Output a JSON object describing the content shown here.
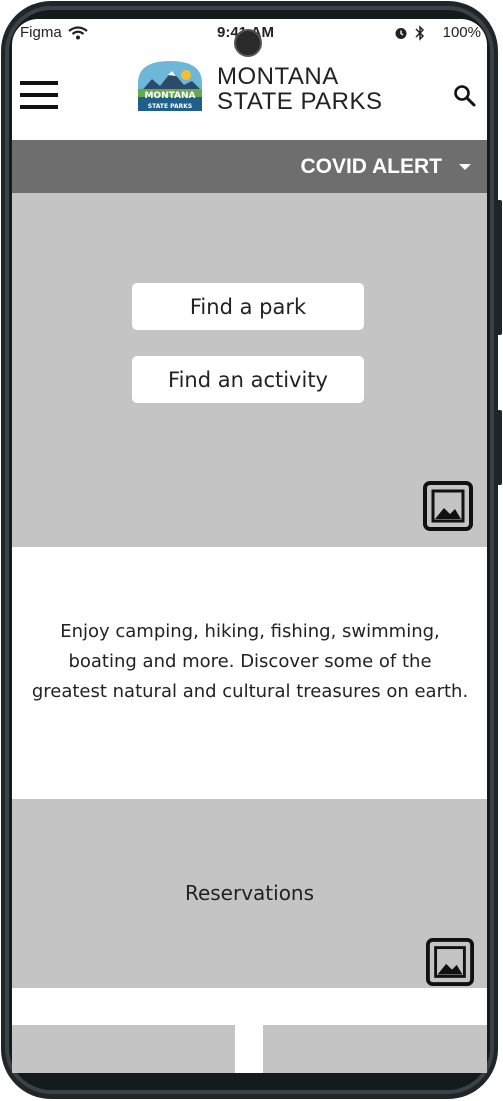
{
  "status_bar": {
    "carrier": "Figma",
    "time": "9:41 AM",
    "battery": "100%"
  },
  "header": {
    "logo_text_line1": "MONTANA",
    "logo_text_line2": "STATE PARKS",
    "title_line1": "MONTANA",
    "title_line2": "STATE PARKS"
  },
  "alert": {
    "label": "COVID ALERT"
  },
  "hero": {
    "find_park_label": "Find a park",
    "find_activity_label": "Find an activity"
  },
  "intro": {
    "text": "Enjoy camping, hiking, fishing, swimming, boating and more. Discover some of the greatest natural and cultural treasures on earth."
  },
  "reservations": {
    "title": "Reservations"
  },
  "icons": [
    "menu-icon",
    "search-icon",
    "wifi-icon",
    "alarm-icon",
    "bluetooth-icon",
    "image-placeholder-icon",
    "chevron-down-icon"
  ],
  "colors": {
    "alert_bar": "#6e6e6e",
    "placeholder": "#c4c4c4",
    "frame": "#1e2326"
  }
}
